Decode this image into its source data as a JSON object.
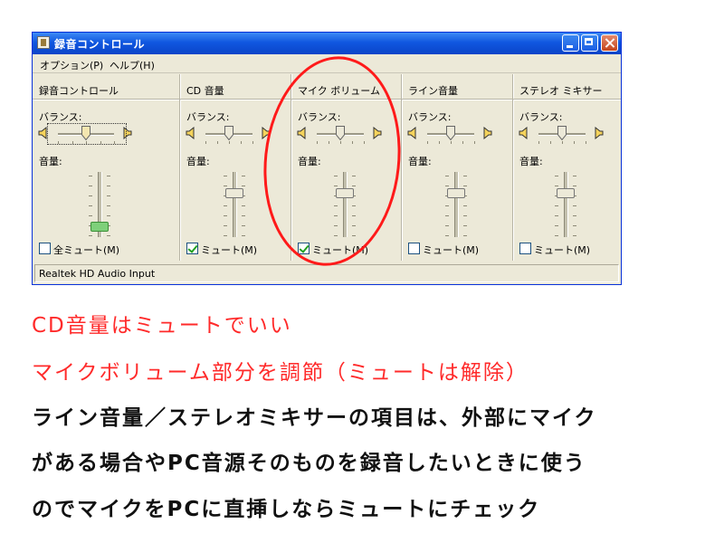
{
  "window": {
    "title": "録音コントロール",
    "menu": [
      "オプション(P)",
      "ヘルプ(H)"
    ],
    "status": "Realtek HD Audio Input",
    "title_color": "#1057e0",
    "annotation_color": "#ff1a1a"
  },
  "columns": [
    {
      "heading": "録音コントロール",
      "balance_label": "バランス:",
      "volume_label": "音量:",
      "mute_label": "全ミュート(M)",
      "mute_checked": false,
      "volume_level": 0.1,
      "balance": 0.5
    },
    {
      "heading": "CD 音量",
      "balance_label": "バランス:",
      "volume_label": "音量:",
      "mute_label": "ミュート(M)",
      "mute_checked": true,
      "volume_level": 0.7,
      "balance": 0.5
    },
    {
      "heading": "マイク ボリューム",
      "balance_label": "バランス:",
      "volume_label": "音量:",
      "mute_label": "ミュート(M)",
      "mute_checked": true,
      "volume_level": 0.7,
      "balance": 0.5
    },
    {
      "heading": "ライン音量",
      "balance_label": "バランス:",
      "volume_label": "音量:",
      "mute_label": "ミュート(M)",
      "mute_checked": false,
      "volume_level": 0.7,
      "balance": 0.5
    },
    {
      "heading": "ステレオ ミキサー",
      "balance_label": "バランス:",
      "volume_label": "音量:",
      "mute_label": "ミュート(M)",
      "mute_checked": false,
      "volume_level": 0.7,
      "balance": 0.5
    }
  ],
  "notes": {
    "line1": "CD音量はミュートでいい",
    "line2": "マイクボリューム部分を調節（ミュートは解除）",
    "line3": "ライン音量／ステレオミキサーの項目は、外部にマイク",
    "line4": "がある場合やPC音源そのものを録音したいときに使う",
    "line5": "のでマイクをPCに直挿しならミュートにチェック"
  }
}
